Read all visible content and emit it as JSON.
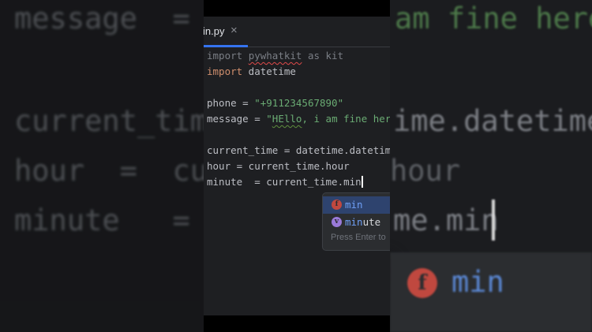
{
  "background": {
    "lines": [
      {
        "text": "message  =  "
      },
      {
        "text": "current_tim"
      },
      {
        "text": "hour  =  cur"
      },
      {
        "text": "minute   =  c"
      }
    ],
    "right": {
      "r1": "am fine here",
      "r2": "ime.datetime",
      "r3": "hour",
      "r4": "me.min"
    },
    "popup": {
      "icon": "f",
      "text": "min"
    }
  },
  "editor": {
    "tab": {
      "label": "in.py",
      "close": "×"
    },
    "code": {
      "l1_kw": "import",
      "l1_mod": "pywhatkit",
      "l1_rest": " as kit",
      "l2_kw": "import",
      "l2_rest": " datetime",
      "l4_pre": "phone = ",
      "l4_str": "\"+911234567890\"",
      "l5_pre": "message = ",
      "l5_str_a": "\"",
      "l5_str_b": "HEllo",
      "l5_str_c": ", i am fine here",
      "l7": "current_time = datetime.datetime",
      "l8": "hour = current_time.hour",
      "l9": "minute  = current_time.min"
    },
    "completion": {
      "items": [
        {
          "icon": "f",
          "match": "min",
          "rest": ""
        },
        {
          "icon": "v",
          "match": "min",
          "rest": "ute"
        }
      ],
      "hint": "Press Enter to"
    }
  },
  "colors": {
    "accent": "#3574f0",
    "keyword": "#cf8e6d",
    "string": "#6aab73"
  }
}
